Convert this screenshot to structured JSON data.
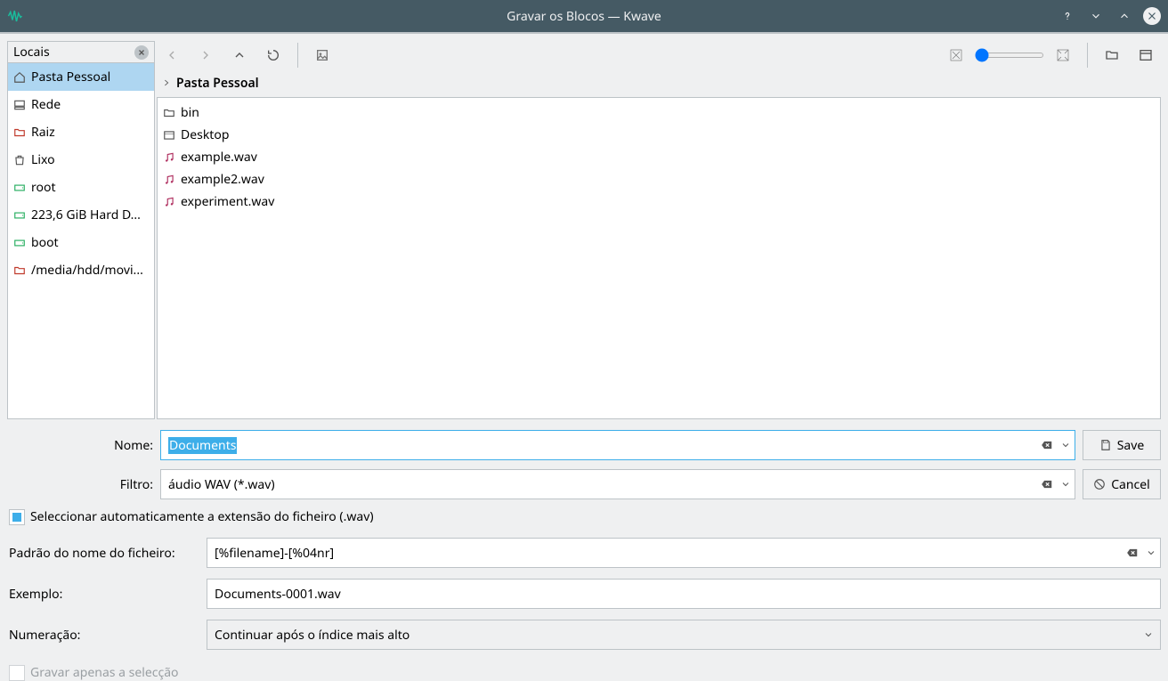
{
  "window": {
    "title": "Gravar os Blocos — Kwave"
  },
  "places": {
    "header": "Locais",
    "items": [
      {
        "label": "Pasta Pessoal",
        "icon": "home",
        "selected": true
      },
      {
        "label": "Rede",
        "icon": "network"
      },
      {
        "label": "Raiz",
        "icon": "folder-red"
      },
      {
        "label": "Lixo",
        "icon": "trash"
      },
      {
        "label": "root",
        "icon": "drive"
      },
      {
        "label": "223,6 GiB Hard D...",
        "icon": "drive"
      },
      {
        "label": "boot",
        "icon": "drive"
      },
      {
        "label": "/media/hdd/movi...",
        "icon": "folder-red"
      }
    ]
  },
  "breadcrumb": {
    "current": "Pasta Pessoal"
  },
  "files": [
    {
      "name": "bin",
      "type": "folder"
    },
    {
      "name": "Desktop",
      "type": "folder-open"
    },
    {
      "name": "example.wav",
      "type": "audio"
    },
    {
      "name": "example2.wav",
      "type": "audio"
    },
    {
      "name": "experiment.wav",
      "type": "audio"
    }
  ],
  "form": {
    "name_label": "Nome:",
    "name_value": "Documents",
    "filter_label": "Filtro:",
    "filter_value": "áudio WAV (*.wav)",
    "save_label": "Save",
    "cancel_label": "Cancel"
  },
  "autoext": {
    "label": "Seleccionar automaticamente a extensão do ficheiro (.wav)"
  },
  "pattern": {
    "label": "Padrão do nome do ficheiro:",
    "value": "[%filename]-[%04nr]"
  },
  "example": {
    "label": "Exemplo:",
    "value": "Documents-0001.wav"
  },
  "numbering": {
    "label": "Numeração:",
    "value": "Continuar após o índice mais alto"
  },
  "selection_only": {
    "label": "Gravar apenas a selecção"
  }
}
